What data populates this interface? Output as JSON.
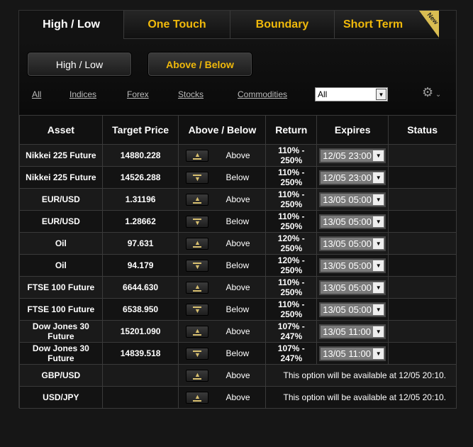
{
  "tabs": [
    {
      "label": "High / Low"
    },
    {
      "label": "One Touch"
    },
    {
      "label": "Boundary"
    },
    {
      "label": "Short Term",
      "badge": "New"
    }
  ],
  "sub_buttons": [
    "High / Low",
    "Above / Below"
  ],
  "filters": [
    "All",
    "Indices",
    "Forex",
    "Stocks",
    "Commodities"
  ],
  "filter_select": "All",
  "columns": [
    "Asset",
    "Target Price",
    "Above / Below",
    "Return",
    "Expires",
    "Status"
  ],
  "rows": [
    {
      "asset": "Nikkei 225 Future",
      "target": "14880.228",
      "dir": "Above",
      "ret": "110% - 250%",
      "exp": "12/05 23:00"
    },
    {
      "asset": "Nikkei 225 Future",
      "target": "14526.288",
      "dir": "Below",
      "ret": "110% - 250%",
      "exp": "12/05 23:00"
    },
    {
      "asset": "EUR/USD",
      "target": "1.31196",
      "dir": "Above",
      "ret": "110% - 250%",
      "exp": "13/05 05:00"
    },
    {
      "asset": "EUR/USD",
      "target": "1.28662",
      "dir": "Below",
      "ret": "110% - 250%",
      "exp": "13/05 05:00"
    },
    {
      "asset": "Oil",
      "target": "97.631",
      "dir": "Above",
      "ret": "120% - 250%",
      "exp": "13/05 05:00"
    },
    {
      "asset": "Oil",
      "target": "94.179",
      "dir": "Below",
      "ret": "120% - 250%",
      "exp": "13/05 05:00"
    },
    {
      "asset": "FTSE 100 Future",
      "target": "6644.630",
      "dir": "Above",
      "ret": "110% - 250%",
      "exp": "13/05 05:00"
    },
    {
      "asset": "FTSE 100 Future",
      "target": "6538.950",
      "dir": "Below",
      "ret": "110% - 250%",
      "exp": "13/05 05:00"
    },
    {
      "asset": "Dow Jones 30 Future",
      "target": "15201.090",
      "dir": "Above",
      "ret": "107% - 247%",
      "exp": "13/05 11:00"
    },
    {
      "asset": "Dow Jones 30 Future",
      "target": "14839.518",
      "dir": "Below",
      "ret": "107% - 247%",
      "exp": "13/05 11:00"
    },
    {
      "asset": "GBP/USD",
      "target": "",
      "dir": "Above",
      "note": "This option will be available at 12/05 20:10."
    },
    {
      "asset": "USD/JPY",
      "target": "",
      "dir": "Above",
      "note": "This option will be available at 12/05 20:10."
    }
  ],
  "colors": {
    "accent": "#f0b90b",
    "badge": "#d9bd52"
  }
}
